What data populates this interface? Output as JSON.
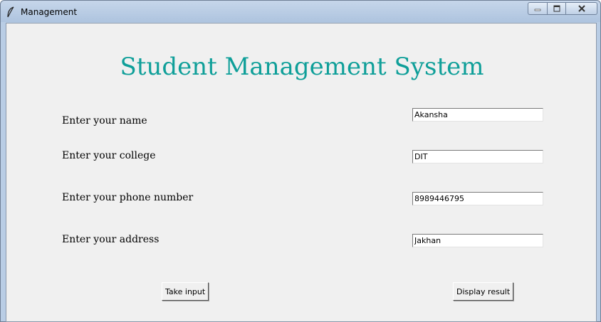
{
  "window": {
    "title": "Management",
    "controls": {
      "minimize": "minimize-icon",
      "maximize": "maximize-icon",
      "close": "close-icon"
    }
  },
  "app": {
    "heading": "Student Management System",
    "heading_color": "#0f9f99",
    "form": {
      "name_label": "Enter your name",
      "name_value": "Akansha",
      "college_label": "Enter your college",
      "college_value": "DIT",
      "phone_label": "Enter your phone number",
      "phone_value": "8989446795",
      "address_label": "Enter your address",
      "address_value": "Jakhan"
    },
    "buttons": {
      "take_input": "Take input",
      "display_result": "Display result"
    }
  }
}
